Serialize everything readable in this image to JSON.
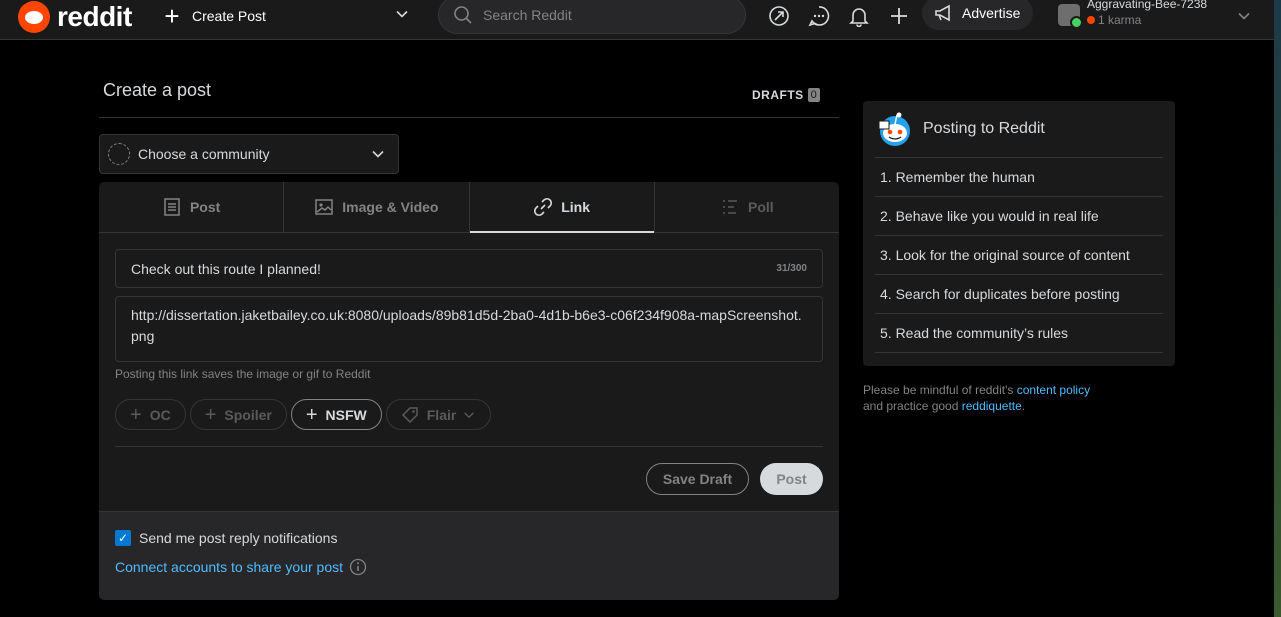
{
  "header": {
    "logo_text": "reddit",
    "create_post_label": "Create Post",
    "search_placeholder": "Search Reddit",
    "advertise_label": "Advertise",
    "username": "Aggravating-Bee-7238",
    "karma": "1 karma"
  },
  "main": {
    "page_title": "Create a post",
    "drafts_label": "DRAFTS",
    "drafts_count": "0",
    "community_label": "Choose a community",
    "tabs": [
      {
        "label": "Post",
        "icon": "document-icon"
      },
      {
        "label": "Image & Video",
        "icon": "image-icon"
      },
      {
        "label": "Link",
        "icon": "link-icon"
      },
      {
        "label": "Poll",
        "icon": "poll-icon"
      }
    ],
    "active_tab": "Link",
    "title_value": "Check out this route I planned!",
    "title_count": "31/300",
    "url_value": "http://dissertation.jaketbailey.co.uk:8080/uploads/89b81d5d-2ba0-4d1b-b6e3-c06f234f908a-mapScreenshot.png",
    "hint": "Posting this link saves the image or gif to Reddit",
    "pills": {
      "oc": "OC",
      "spoiler": "Spoiler",
      "nsfw": "NSFW",
      "flair": "Flair"
    },
    "save_draft_label": "Save Draft",
    "post_label": "Post",
    "notifications_label": "Send me post reply notifications",
    "notifications_checked": true,
    "connect_label": "Connect accounts to share your post"
  },
  "sidebar": {
    "title": "Posting to Reddit",
    "rules": [
      "1. Remember the human",
      "2. Behave like you would in real life",
      "3. Look for the original source of content",
      "4. Search for duplicates before posting",
      "5. Read the community’s rules"
    ]
  },
  "policy": {
    "text1": "Please be mindful of reddit's ",
    "link1": "content policy",
    "text2": "and practice good ",
    "link2": "reddiquette",
    "text3": "."
  },
  "colors": {
    "brand": "#ff4500",
    "link": "#4fbcff",
    "checkbox": "#0079d3"
  }
}
